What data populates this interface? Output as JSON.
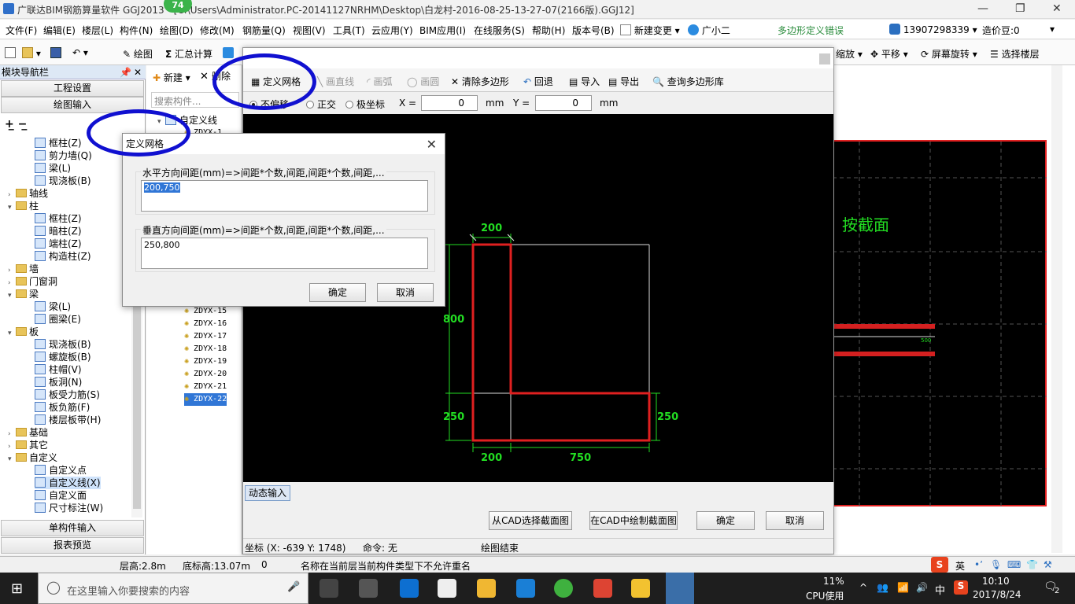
{
  "window": {
    "title": "广联达BIM钢筋算量软件 GGJ2013 - [C:\\Users\\Administrator.PC-20141127NRHM\\Desktop\\白龙村-2016-08-25-13-27-07(2166版).GGJ12]",
    "badge": "74"
  },
  "menu": {
    "items": [
      "文件(F)",
      "编辑(E)",
      "楼层(L)",
      "构件(N)",
      "绘图(D)",
      "修改(M)",
      "钢筋量(Q)",
      "视图(V)",
      "工具(T)",
      "云应用(Y)",
      "BIM应用(I)",
      "在线服务(S)",
      "帮助(H)",
      "版本号(B)"
    ],
    "new_change": "新建变更",
    "assistant": "广小二",
    "error_msg": "多边形定义错误",
    "phone": "13907298339",
    "price_bean": "造价豆:0"
  },
  "toolbar": {
    "draw": "绘图",
    "sum_calc": "汇总计算",
    "zoom": "缩放",
    "pan": "平移",
    "rotate": "屏幕旋转",
    "select_floor": "选择楼层"
  },
  "left_nav": {
    "title": "模块导航栏",
    "project_settings": "工程设置",
    "draw_input": "绘图输入",
    "single_input": "单构件输入",
    "report_preview": "报表预览",
    "tree": [
      {
        "level": 2,
        "label": "框柱(Z)"
      },
      {
        "level": 2,
        "label": "剪力墙(Q)"
      },
      {
        "level": 2,
        "label": "梁(L)"
      },
      {
        "level": 2,
        "label": "现浇板(B)"
      },
      {
        "level": 1,
        "label": "轴线",
        "folder": true,
        "open": false
      },
      {
        "level": 1,
        "label": "柱",
        "folder": true,
        "open": true
      },
      {
        "level": 2,
        "label": "框柱(Z)"
      },
      {
        "level": 2,
        "label": "暗柱(Z)"
      },
      {
        "level": 2,
        "label": "端柱(Z)"
      },
      {
        "level": 2,
        "label": "构造柱(Z)"
      },
      {
        "level": 1,
        "label": "墙",
        "folder": true,
        "open": false
      },
      {
        "level": 1,
        "label": "门窗洞",
        "folder": true,
        "open": false
      },
      {
        "level": 1,
        "label": "梁",
        "folder": true,
        "open": true
      },
      {
        "level": 2,
        "label": "梁(L)"
      },
      {
        "level": 2,
        "label": "圈梁(E)"
      },
      {
        "level": 1,
        "label": "板",
        "folder": true,
        "open": true
      },
      {
        "level": 2,
        "label": "现浇板(B)"
      },
      {
        "level": 2,
        "label": "螺旋板(B)"
      },
      {
        "level": 2,
        "label": "柱帽(V)"
      },
      {
        "level": 2,
        "label": "板洞(N)"
      },
      {
        "level": 2,
        "label": "板受力筋(S)"
      },
      {
        "level": 2,
        "label": "板负筋(F)"
      },
      {
        "level": 2,
        "label": "楼层板带(H)"
      },
      {
        "level": 1,
        "label": "基础",
        "folder": true,
        "open": false
      },
      {
        "level": 1,
        "label": "其它",
        "folder": true,
        "open": false
      },
      {
        "level": 1,
        "label": "自定义",
        "folder": true,
        "open": true
      },
      {
        "level": 2,
        "label": "自定义点"
      },
      {
        "level": 2,
        "label": "自定义线(X)",
        "selected": true
      },
      {
        "level": 2,
        "label": "自定义面"
      },
      {
        "level": 2,
        "label": "尺寸标注(W)"
      }
    ]
  },
  "mid_panel": {
    "new_btn": "新建",
    "delete_btn": "删除",
    "search_placeholder": "搜索构件...",
    "root": "自定义线",
    "items": [
      "ZDYX-1",
      "ZDYX-15",
      "ZDYX-16",
      "ZDYX-17",
      "ZDYX-18",
      "ZDYX-19",
      "ZDYX-20",
      "ZDYX-21",
      "ZDYX-22"
    ]
  },
  "poly_editor": {
    "define_grid": "定义网格",
    "line": "画直线",
    "arc": "画弧",
    "circle": "画圆",
    "clear": "清除多边形",
    "undo": "回退",
    "import": "导入",
    "export": "导出",
    "query": "查询多边形库",
    "opt_no_offset": "不偏移",
    "opt_ortho": "正交",
    "opt_polar": "极坐标",
    "x_label": "X =",
    "y_label": "Y =",
    "x_value": "0",
    "y_value": "0",
    "unit": "mm",
    "dyn_input": "动态输入",
    "btn_from_cad": "从CAD选择截面图",
    "btn_draw_cad": "在CAD中绘制截面图",
    "btn_ok": "确定",
    "btn_cancel": "取消",
    "status_coord": "坐标 (X: -639 Y: 1748)",
    "status_cmd": "命令: 无",
    "status_end": "绘图结束",
    "dims": {
      "top": "200",
      "left_upper": "800",
      "left_lower": "250",
      "right": "250",
      "bottom_left": "200",
      "bottom_right": "750"
    }
  },
  "grid_dialog": {
    "title": "定义网格",
    "h_label": "水平方向间距(mm)=>间距*个数,间距,间距*个数,间距,...",
    "h_value": "200,750",
    "v_label": "垂直方向间距(mm)=>间距*个数,间距,间距*个数,间距,...",
    "v_value": "250,800",
    "ok": "确定",
    "cancel": "取消"
  },
  "right_canvas": {
    "section_label": "按截面",
    "small_dim": "500"
  },
  "statusbar": {
    "floor_height": "层高:2.8m",
    "base_height": "底标高:13.07m",
    "count": "0",
    "message": "名称在当前层当前构件类型下不允许重名"
  },
  "taskbar": {
    "search_placeholder": "在这里输入你要搜索的内容",
    "cpu_pct": "11%",
    "cpu_label": "CPU使用",
    "ime": "中",
    "ime2": "英",
    "time": "10:10",
    "date": "2017/8/24",
    "notif": "2"
  },
  "colors": {
    "accent_red": "#e02020",
    "dim_green": "#22dd22",
    "annotation_blue": "#1010d0"
  }
}
